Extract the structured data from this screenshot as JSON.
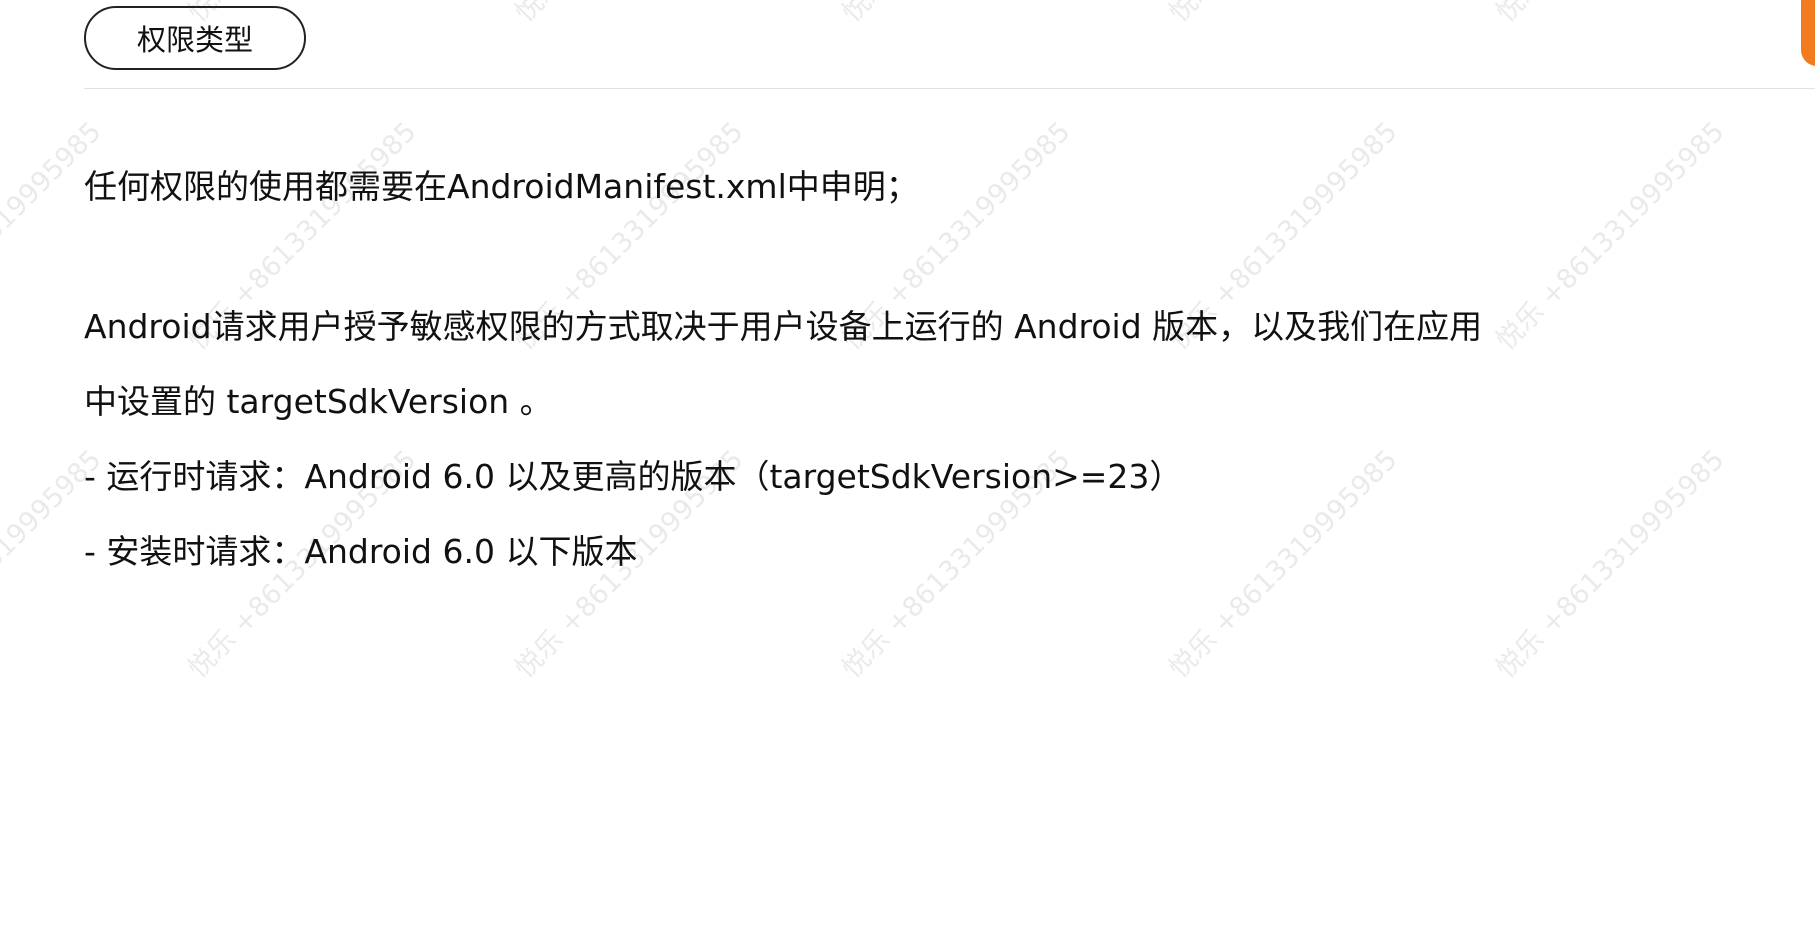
{
  "watermark": {
    "text": "悦乐 +8613319995985"
  },
  "section": {
    "tag_label": "权限类型"
  },
  "body": {
    "line1": "任何权限的使用都需要在AndroidManifest.xml中申明；",
    "line2": "Android请求用户授予敏感权限的方式取决于用户设备上运行的 Android 版本，以及我们在应用",
    "line3": "中设置的 targetSdkVersion 。",
    "line4": "- 运行时请求：Android 6.0 以及更高的版本（targetSdkVersion>=23）",
    "line5": "- 安装时请求：Android 6.0 以下版本"
  },
  "colors": {
    "accent_badge": "#f47a1f",
    "text": "#111111",
    "divider": "#e2e2e2"
  }
}
